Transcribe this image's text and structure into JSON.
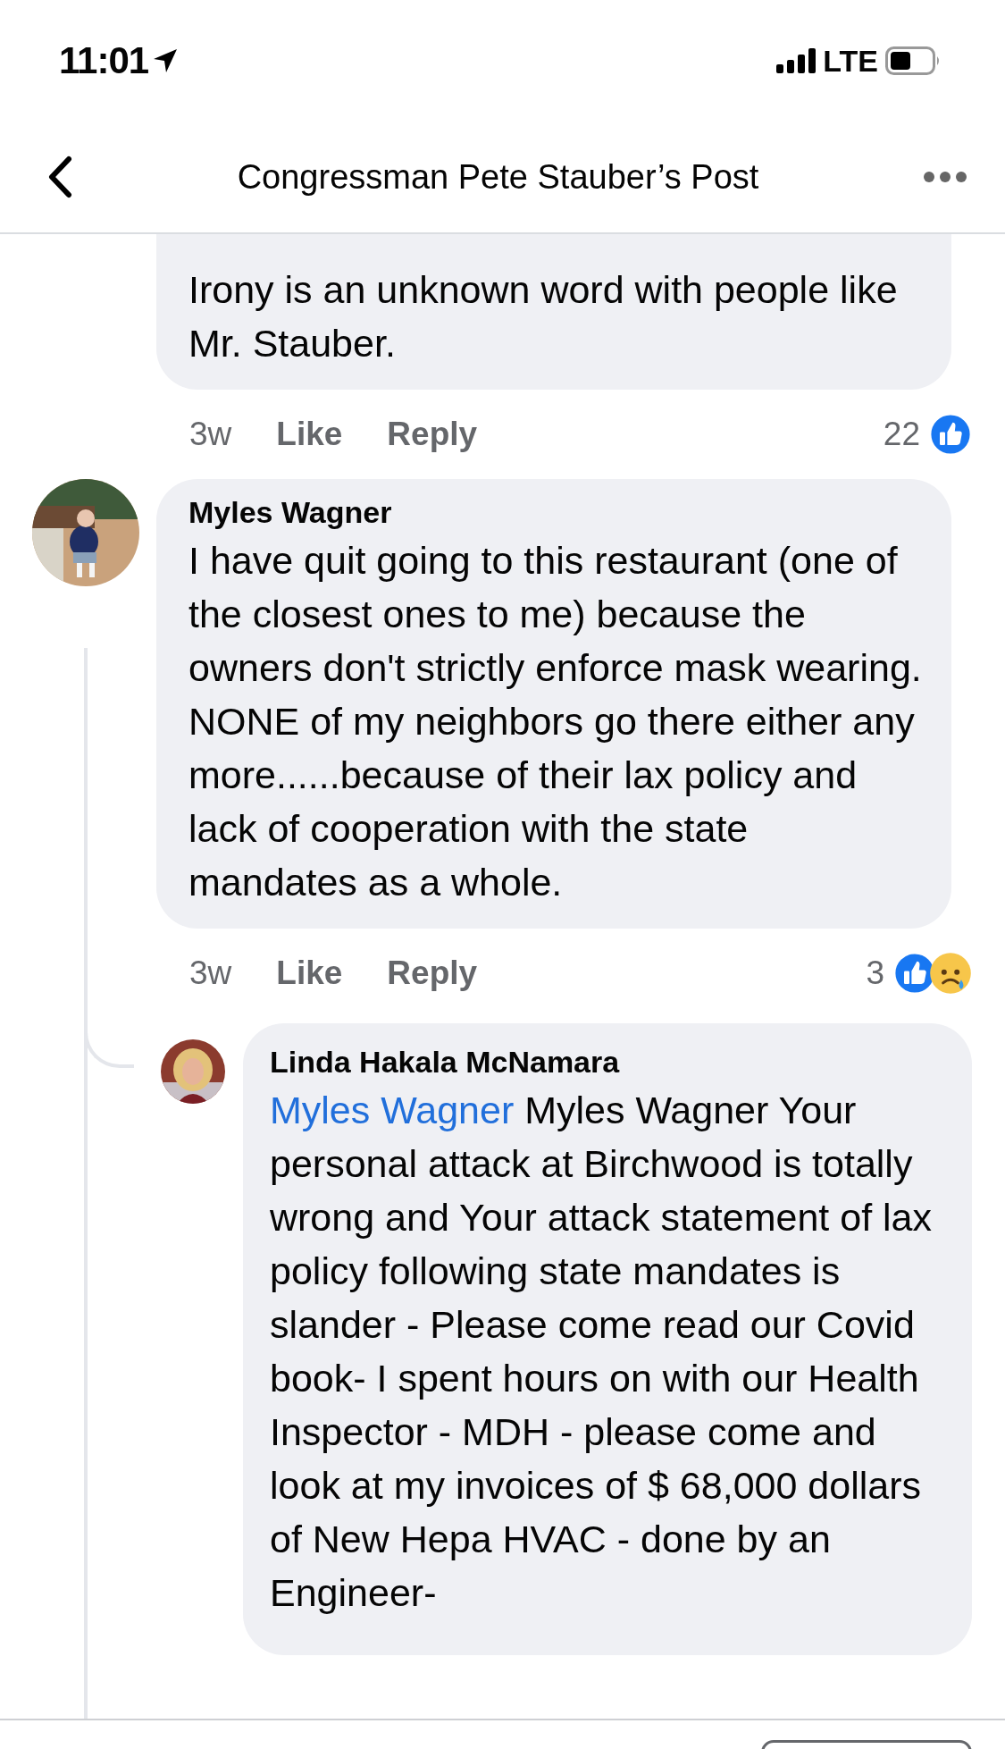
{
  "status_bar": {
    "time": "11:01",
    "network": "LTE"
  },
  "header": {
    "title": "Congressman Pete Stauber’s Post"
  },
  "comments": [
    {
      "text": "Irony is an unknown word with people like Mr. Stauber.",
      "age": "3w",
      "actions": [
        "Like",
        "Reply"
      ],
      "reaction_count": "22",
      "reactions": [
        {
          "kind": "like"
        }
      ]
    },
    {
      "author": "Myles Wagner",
      "text": "I have quit going to this restaurant (one of the closest ones to me) because the owners don't strictly enforce mask wearing.   NONE of my neighbors go there either any more......because of their lax policy and lack of cooperation with the state mandates as a whole.",
      "age": "3w",
      "actions": [
        "Like",
        "Reply"
      ],
      "reaction_count": "3",
      "reactions": [
        {
          "kind": "like"
        },
        {
          "kind": "sad"
        }
      ],
      "replies": [
        {
          "author": "Linda Hakala McNamara",
          "mention": "Myles Wagner",
          "text": "Myles Wagner Your personal attack at Birchwood is totally wrong and Your attack statement of lax policy following state mandates is slander - Please come read our Covid book- I spent hours on with our Health Inspector - MDH - please come and look at my invoices of $ 68,000 dollars of New Hepa HVAC - done by an Engineer-"
        }
      ]
    }
  ]
}
